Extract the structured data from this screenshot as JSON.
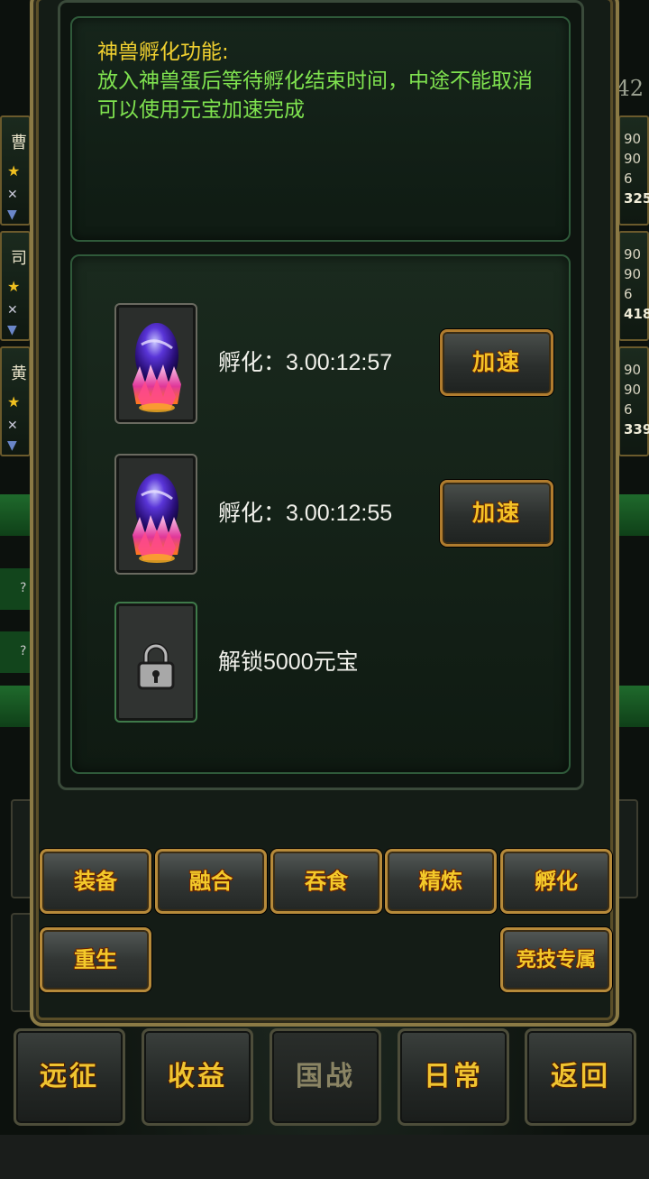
{
  "description": {
    "title": "神兽孵化功能:",
    "line1": "放入神兽蛋后等待孵化结束时间，中途不能取消",
    "line2": "可以使用元宝加速完成"
  },
  "slots": [
    {
      "status": "孵化：3.00:12:57",
      "button": "加速"
    },
    {
      "status": "孵化：3.00:12:55",
      "button": "加速"
    },
    {
      "status": "解锁5000元宝"
    }
  ],
  "tabs": {
    "equip": "装备",
    "fuse": "融合",
    "devour": "吞食",
    "refine": "精炼",
    "hatch": "孵化",
    "rebirth": "重生",
    "arena": "竞技专属"
  },
  "nav": {
    "expedition": "远征",
    "income": "收益",
    "national_war": "国战",
    "daily": "日常",
    "back": "返回"
  },
  "side": {
    "cards": [
      {
        "name": "曹"
      },
      {
        "name": "司"
      },
      {
        "name": "黄"
      }
    ],
    "right_number": "42",
    "right_cards": [
      {
        "v1": "90",
        "v2": "90",
        "v3": "6",
        "v4": "325"
      },
      {
        "v1": "90",
        "v2": "90",
        "v3": "6",
        "v4": "418"
      },
      {
        "v1": "90",
        "v2": "90",
        "v3": "6",
        "v4": "339"
      }
    ],
    "q_marks": [
      "?",
      "?"
    ]
  },
  "colors": {
    "title_yellow": "#f0d030",
    "desc_green": "#7fe24f",
    "button_gold": "#f5c226",
    "frame_gold": "#8b7a45"
  }
}
